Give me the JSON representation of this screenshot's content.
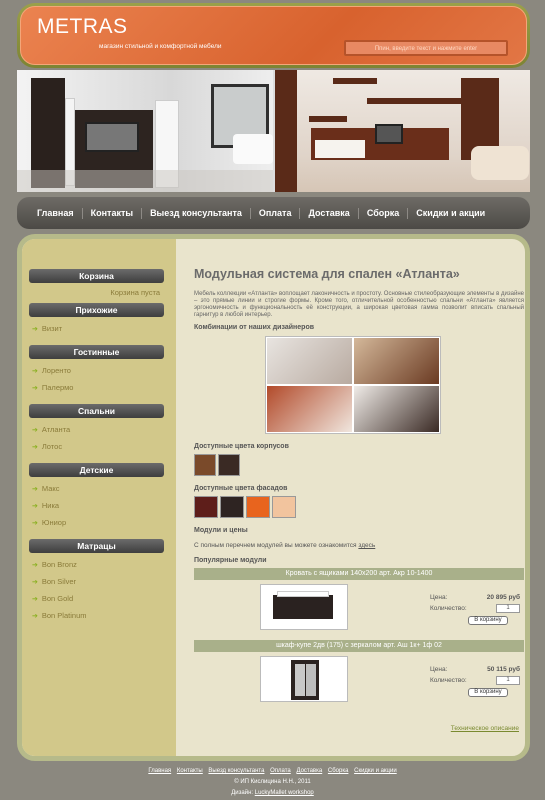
{
  "header": {
    "logo": "METRAS",
    "tagline": "магазин стильной и комфортной мебели",
    "search_placeholder": "Ппин, введите текст и нажмите enter"
  },
  "nav": {
    "items": [
      "Главная",
      "Контакты",
      "Выезд консультанта",
      "Оплата",
      "Доставка",
      "Сборка",
      "Скидки и акции"
    ]
  },
  "sidebar": {
    "cart_title": "Корзина",
    "cart_empty": "Корзина пуста",
    "sections": [
      {
        "title": "Прихожие",
        "items": [
          "Визит"
        ]
      },
      {
        "title": "Гостинные",
        "items": [
          "Лоренто",
          "Палермо"
        ]
      },
      {
        "title": "Спальни",
        "items": [
          "Атланта",
          "Лотос"
        ]
      },
      {
        "title": "Детские",
        "items": [
          "Макс",
          "Ника",
          "Юниор"
        ]
      },
      {
        "title": "Матрацы",
        "items": [
          "Bon Bronz",
          "Bon Silver",
          "Bon Gold",
          "Bon Platinum"
        ]
      }
    ]
  },
  "content": {
    "title": "Модульная система для спален «Атланта»",
    "description": "Мебель коллекции «Атланта» воплощает лаконичность и простоту. Основные стилеобразующие элементы в дизайне – это прямые линии и строгие формы. Кроме того, отличительной особенностью спальни «Атланта» является эргономичность и функциональность её конструкции, а широкая цветовая гамма позволит вписать спальный гарнитур в любой интерьер.",
    "combinations_label": "Комбинации от наших дизайнеров",
    "body_colors_label": "Доступные цвета корпусов",
    "facade_colors_label": "Доступные цвета фасадов",
    "modules_label": "Модули и цены",
    "full_list_text": "С полным перечнем модулей вы можете ознакомится",
    "full_list_link": "здесь",
    "popular_label": "Популярные модули",
    "colors": {
      "body": [
        "#7a4a2a",
        "#3a2a24"
      ],
      "facade": [
        "#5e1e1a",
        "#2e2422",
        "#e8641e",
        "#f2c49e"
      ]
    },
    "products": [
      {
        "name": "Кровать с ящиками 140х200 арт. Акр 10-1400",
        "price_label": "Цена:",
        "price": "20 895 руб",
        "qty_label": "Количество:",
        "qty": "1",
        "cart_button": "В корзину"
      },
      {
        "name": "шкаф-купе 2дв (175) с зеркалом арт. Аш 1к+ 1ф 02",
        "price_label": "Цена:",
        "price": "50 115 руб",
        "qty_label": "Количество:",
        "qty": "1",
        "cart_button": "В корзину"
      }
    ],
    "tech_link": "Техническое описание"
  },
  "footer": {
    "links": [
      "Главная",
      "Контакты",
      "Выезд консультанта",
      "Оплата",
      "Доставка",
      "Сборка",
      "Скидки и акции"
    ],
    "copyright": "© ИП Кислицина Н.Н., 2011",
    "design_label": "Дизайн:",
    "design_link": "LuckyMallet workshop"
  }
}
